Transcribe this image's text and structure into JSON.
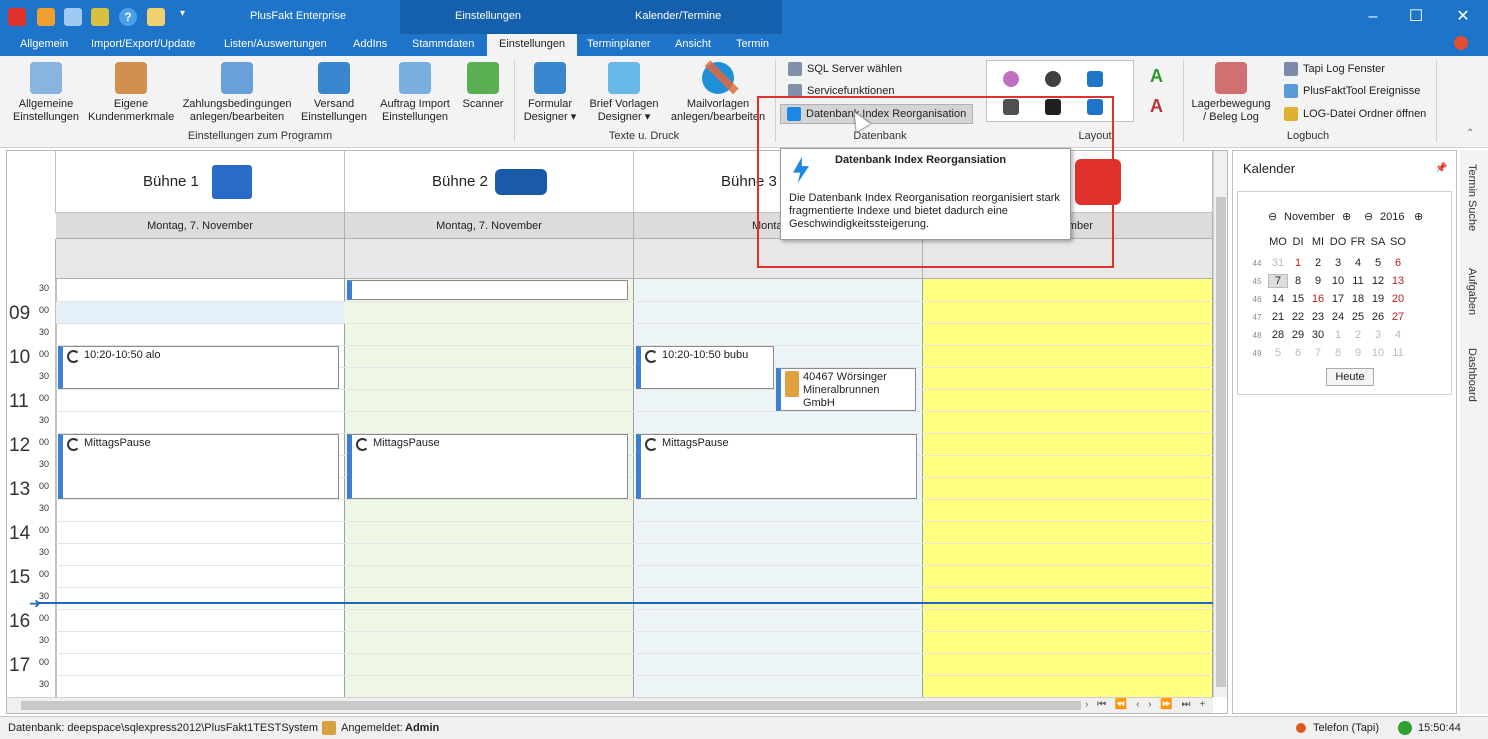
{
  "window": {
    "app_title": "PlusFakt Enterprise",
    "context_tabs": [
      "Einstellungen",
      "Kalender/Termine"
    ],
    "controls": [
      "–",
      "☐",
      "✕"
    ]
  },
  "tabs": [
    "Allgemein",
    "Import/Export/Update",
    "Listen/Auswertungen",
    "AddIns",
    "Stammdaten",
    "Einstellungen",
    "Terminplaner",
    "Ansicht",
    "Termin"
  ],
  "ribbon": {
    "prog": {
      "items": [
        "Allgemeine\nEinstellungen",
        "Eigene\nKundenmerkmale",
        "Zahlungsbedingungen\nanlegen/bearbeiten",
        "Versand\nEinstellungen",
        "Auftrag Import\nEinstellungen",
        "Scanner"
      ],
      "group": "Einstellungen zum Programm"
    },
    "texte": {
      "items": [
        "Formular\nDesigner ▾",
        "Brief Vorlagen\nDesigner ▾",
        "Mailvorlagen\nanlegen/bearbeiten"
      ],
      "group": "Texte u. Druck"
    },
    "db": {
      "items": [
        "SQL Server wählen",
        "Servicefunktionen",
        "Datenbank Index Reorganisation"
      ],
      "group": "Datenbank"
    },
    "layout": {
      "group": "Layout"
    },
    "lager": {
      "label": "Lagerbewegung\n/ Beleg Log"
    },
    "log": {
      "items": [
        "Tapi Log Fenster",
        "PlusFaktTool Ereignisse",
        "LOG-Datei Ordner öffnen"
      ],
      "group": "Logbuch"
    }
  },
  "calendar": {
    "resources": [
      "Bühne 1",
      "Bühne 2",
      "Bühne 3"
    ],
    "date": "Montag, 7. November",
    "date_partial": "Montag, 7.",
    "date_partial2": "November",
    "hours": [
      "09",
      "10",
      "11",
      "12",
      "13",
      "14",
      "15",
      "16",
      "17"
    ],
    "m00": "00",
    "m30": "30",
    "appts": {
      "a1": "10:20-10:50 alo",
      "a2": "10:20-10:50 bubu",
      "a3": "40467 Wörsinger\nMineralbrunnen GmbH",
      "p1": "MittagsPause",
      "p2": "MittagsPause",
      "p3": "MittagsPause"
    }
  },
  "tooltip": {
    "title": "Datenbank Index Reorgansiation",
    "body": "Die Datenbank Index Reorganisation reorganisiert stark fragmentierte Indexe und bietet dadurch eine Geschwindigkeitssteigerung."
  },
  "sidebar": {
    "title": "Kalender",
    "month": "November",
    "year": "2016",
    "weekdays": [
      "MO",
      "DI",
      "MI",
      "DO",
      "FR",
      "SA",
      "SO"
    ],
    "weeks": [
      {
        "kw": "44",
        "d": [
          "31",
          "1",
          "2",
          "3",
          "4",
          "5",
          "6"
        ]
      },
      {
        "kw": "45",
        "d": [
          "7",
          "8",
          "9",
          "10",
          "11",
          "12",
          "13"
        ]
      },
      {
        "kw": "46",
        "d": [
          "14",
          "15",
          "16",
          "17",
          "18",
          "19",
          "20"
        ]
      },
      {
        "kw": "47",
        "d": [
          "21",
          "22",
          "23",
          "24",
          "25",
          "26",
          "27"
        ]
      },
      {
        "kw": "48",
        "d": [
          "28",
          "29",
          "30",
          "1",
          "2",
          "3",
          "4"
        ]
      },
      {
        "kw": "49",
        "d": [
          "5",
          "6",
          "7",
          "8",
          "9",
          "10",
          "11"
        ]
      }
    ],
    "today_btn": "Heute"
  },
  "sidetabs": [
    "Termin Suche",
    "Aufgaben",
    "Dashboard"
  ],
  "status": {
    "db": "Datenbank: deepspace\\sqlexpress2012\\PlusFakt1TESTSystem",
    "login_label": "Angemeldet:",
    "login_user": "Admin",
    "phone": "Telefon (Tapi)",
    "time": "15:50:44"
  },
  "colors": {
    "accent": "#1e74c9",
    "context": "#1560ad",
    "highlight_col": "#ffff80",
    "bay2": "#eef6e4",
    "bay3": "#eef5f8",
    "red": "#e0322a"
  }
}
